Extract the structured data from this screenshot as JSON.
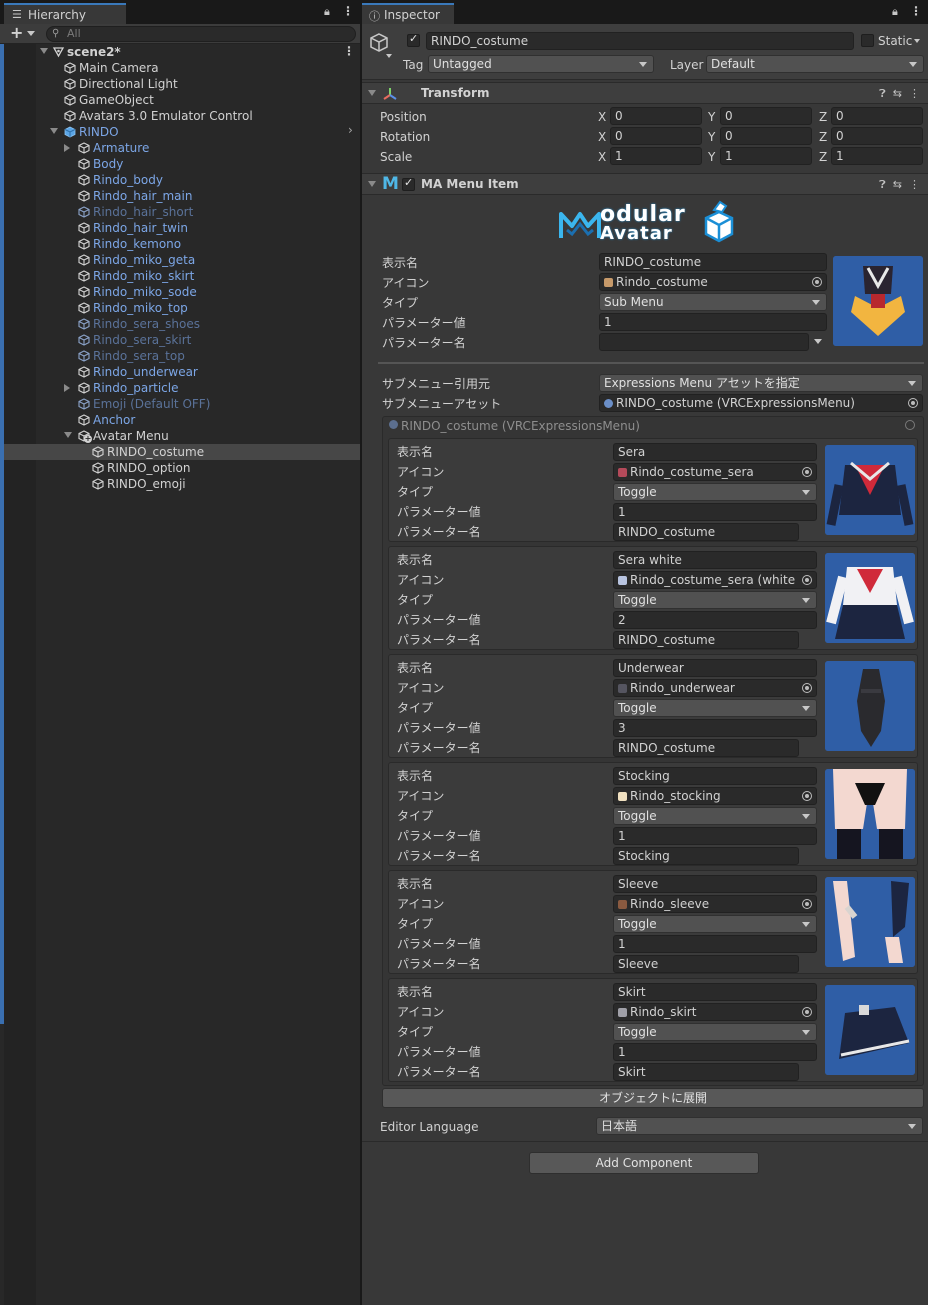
{
  "hierarchy": {
    "tab_label": "Hierarchy",
    "add_label": "+",
    "search_placeholder": "All",
    "items": [
      {
        "label": "scene2*",
        "depth": 0,
        "kind": "scene",
        "arrow": "down",
        "color": "scene"
      },
      {
        "label": "Main Camera",
        "depth": 1,
        "kind": "cube",
        "color": "white"
      },
      {
        "label": "Directional Light",
        "depth": 1,
        "kind": "cube",
        "color": "white"
      },
      {
        "label": "GameObject",
        "depth": 1,
        "kind": "cube",
        "color": "white"
      },
      {
        "label": "Avatars 3.0 Emulator Control",
        "depth": 1,
        "kind": "cube",
        "color": "white"
      },
      {
        "label": "RINDO",
        "depth": 1,
        "kind": "prefab",
        "arrow": "down",
        "color": "blue",
        "chevron": true
      },
      {
        "label": "Armature",
        "depth": 2,
        "kind": "cube",
        "arrow": "right",
        "color": "blue"
      },
      {
        "label": "Body",
        "depth": 2,
        "kind": "cube",
        "color": "blue"
      },
      {
        "label": "Rindo_body",
        "depth": 2,
        "kind": "cube",
        "color": "blue"
      },
      {
        "label": "Rindo_hair_main",
        "depth": 2,
        "kind": "cube",
        "color": "blue"
      },
      {
        "label": "Rindo_hair_short",
        "depth": 2,
        "kind": "cube",
        "color": "dim"
      },
      {
        "label": "Rindo_hair_twin",
        "depth": 2,
        "kind": "cube",
        "color": "blue"
      },
      {
        "label": "Rindo_kemono",
        "depth": 2,
        "kind": "cube",
        "color": "blue"
      },
      {
        "label": "Rindo_miko_geta",
        "depth": 2,
        "kind": "cube",
        "color": "blue"
      },
      {
        "label": "Rindo_miko_skirt",
        "depth": 2,
        "kind": "cube",
        "color": "blue"
      },
      {
        "label": "Rindo_miko_sode",
        "depth": 2,
        "kind": "cube",
        "color": "blue"
      },
      {
        "label": "Rindo_miko_top",
        "depth": 2,
        "kind": "cube",
        "color": "blue"
      },
      {
        "label": "Rindo_sera_shoes",
        "depth": 2,
        "kind": "cube",
        "color": "dim"
      },
      {
        "label": "Rindo_sera_skirt",
        "depth": 2,
        "kind": "cube",
        "color": "dim"
      },
      {
        "label": "Rindo_sera_top",
        "depth": 2,
        "kind": "cube",
        "color": "dim"
      },
      {
        "label": "Rindo_underwear",
        "depth": 2,
        "kind": "cube",
        "color": "blue"
      },
      {
        "label": "Rindo_particle",
        "depth": 2,
        "kind": "cube",
        "arrow": "right",
        "color": "blue"
      },
      {
        "label": "Emoji (Default OFF)",
        "depth": 2,
        "kind": "cube",
        "color": "dim"
      },
      {
        "label": "Anchor",
        "depth": 2,
        "kind": "cube",
        "color": "blue"
      },
      {
        "label": "Avatar Menu",
        "depth": 2,
        "kind": "cube-plus",
        "arrow": "down",
        "color": "white"
      },
      {
        "label": "RINDO_costume",
        "depth": 3,
        "kind": "cube",
        "color": "white",
        "selected": true
      },
      {
        "label": "RINDO_option",
        "depth": 3,
        "kind": "cube",
        "color": "white"
      },
      {
        "label": "RINDO_emoji",
        "depth": 3,
        "kind": "cube",
        "color": "white"
      }
    ]
  },
  "inspector": {
    "tab_label": "Inspector",
    "object_name": "RINDO_costume",
    "static_label": "Static",
    "tag_label": "Tag",
    "tag_value": "Untagged",
    "layer_label": "Layer",
    "layer_value": "Default",
    "transform": {
      "title": "Transform",
      "rows": [
        {
          "label": "Position",
          "x": "0",
          "y": "0",
          "z": "0"
        },
        {
          "label": "Rotation",
          "x": "0",
          "y": "0",
          "z": "0"
        },
        {
          "label": "Scale",
          "x": "1",
          "y": "1",
          "z": "1"
        }
      ],
      "axis_x": "X",
      "axis_y": "Y",
      "axis_z": "Z"
    },
    "ma_menu_item": {
      "title": "MA Menu Item",
      "logo_line1": "odular",
      "logo_line2": "Avatar",
      "display_name_label": "表示名",
      "display_name": "RINDO_costume",
      "icon_label": "アイコン",
      "icon_value": "Rindo_costume",
      "type_label": "タイプ",
      "type_value": "Sub Menu",
      "param_value_label": "パラメーター値",
      "param_value": "1",
      "param_name_label": "パラメーター名",
      "param_name": "",
      "submenu_source_label": "サブメニュー引用元",
      "submenu_source_value": "Expressions Menu アセットを指定",
      "submenu_asset_label": "サブメニューアセット",
      "submenu_asset_value": "RINDO_costume (VRCExpressionsMenu)",
      "nested_title": "RINDO_costume (VRCExpressionsMenu)",
      "entries": [
        {
          "display_name": "Sera",
          "icon": "Rindo_costume_sera",
          "type": "Toggle",
          "param_value": "1",
          "param_name": "RINDO_costume",
          "thumb": "sera"
        },
        {
          "display_name": "Sera white",
          "icon": "Rindo_costume_sera (white)",
          "type": "Toggle",
          "param_value": "2",
          "param_name": "RINDO_costume",
          "thumb": "white"
        },
        {
          "display_name": "Underwear",
          "icon": "Rindo_underwear",
          "type": "Toggle",
          "param_value": "3",
          "param_name": "RINDO_costume",
          "thumb": "underwear"
        },
        {
          "display_name": "Stocking",
          "icon": "Rindo_stocking",
          "type": "Toggle",
          "param_value": "1",
          "param_name": "Stocking",
          "thumb": "stocking"
        },
        {
          "display_name": "Sleeve",
          "icon": "Rindo_sleeve",
          "type": "Toggle",
          "param_value": "1",
          "param_name": "Sleeve",
          "thumb": "sleeve"
        },
        {
          "display_name": "Skirt",
          "icon": "Rindo_skirt",
          "type": "Toggle",
          "param_value": "1",
          "param_name": "Skirt",
          "thumb": "skirt"
        }
      ],
      "expand_button": "オブジェクトに展開",
      "editor_language_label": "Editor Language",
      "editor_language_value": "日本語"
    },
    "add_component_label": "Add Component"
  },
  "colors": {
    "selection_bg": "#474747",
    "accent_blue": "#3a79bb",
    "prefab_blue": "#7ca6e6",
    "thumb_bg": "#2f5ea6"
  }
}
